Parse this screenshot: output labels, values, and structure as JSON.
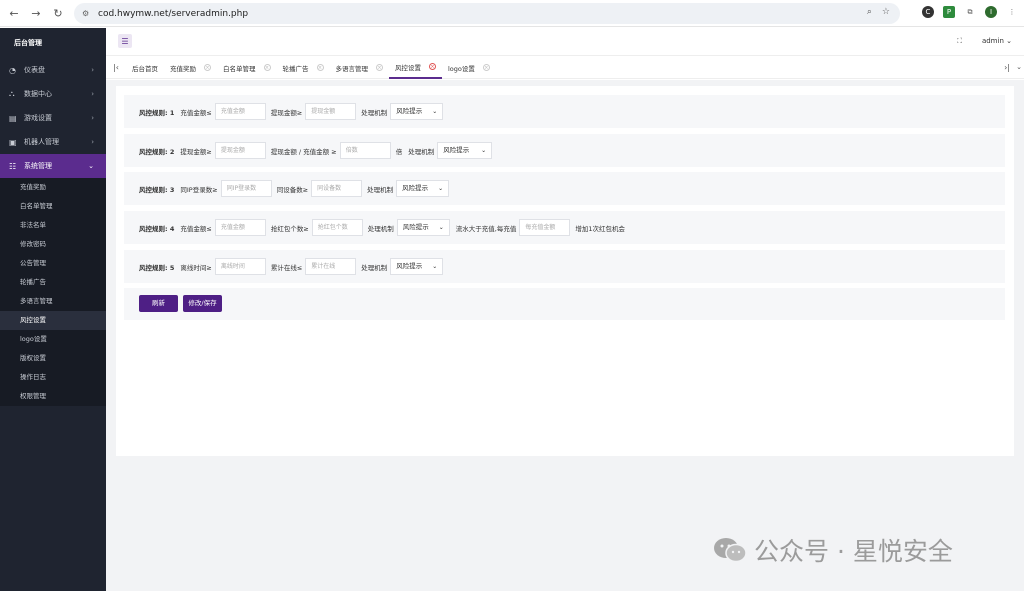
{
  "browser": {
    "url": "cod.hwymw.net/serveradmin.php",
    "profile_initial": "I"
  },
  "sidebar": {
    "title": "后台管理",
    "items": [
      {
        "label": "仪表盘",
        "icon": "dashboard-icon"
      },
      {
        "label": "数据中心",
        "icon": "data-center-icon"
      },
      {
        "label": "游戏设置",
        "icon": "game-settings-icon"
      },
      {
        "label": "机器人管理",
        "icon": "robot-icon"
      },
      {
        "label": "系统管理",
        "icon": "system-icon"
      }
    ],
    "sub_items": [
      "充值奖励",
      "白名单管理",
      "非法名单",
      "修改密码",
      "公告管理",
      "轮播广告",
      "多语言管理",
      "风控设置",
      "logo设置",
      "版权设置",
      "操作日志",
      "权限管理"
    ]
  },
  "header": {
    "admin_label": "admin"
  },
  "tabs": [
    {
      "label": "后台首页"
    },
    {
      "label": "充值奖励"
    },
    {
      "label": "白名单管理"
    },
    {
      "label": "轮播广告"
    },
    {
      "label": "多语言管理"
    },
    {
      "label": "风控设置"
    },
    {
      "label": "logo设置"
    }
  ],
  "rules": {
    "r1": {
      "title": "风控规则: 1",
      "label_a": "充值金额≤",
      "placeholder_a": "充值金额",
      "label_b": "提现金额≥",
      "placeholder_b": "提现金额",
      "label_mech": "处理机制",
      "mech_value": "风险提示"
    },
    "r2": {
      "title": "风控规则: 2",
      "label_a": "提现金额≥",
      "placeholder_a": "提现金额",
      "label_b": "提现金额 / 充值金额 ≥",
      "placeholder_b": "倍数",
      "unit": "倍",
      "label_mech": "处理机制",
      "mech_value": "风险提示"
    },
    "r3": {
      "title": "风控规则: 3",
      "label_a": "同IP登录数≥",
      "placeholder_a": "同IP登录数",
      "label_b": "同设备数≥",
      "placeholder_b": "同设备数",
      "label_mech": "处理机制",
      "mech_value": "风险提示"
    },
    "r4": {
      "title": "风控规则: 4",
      "label_a": "充值金额≤",
      "placeholder_a": "充值金额",
      "label_b": "抢红包个数≥",
      "placeholder_b": "抢红包个数",
      "label_mech": "处理机制",
      "mech_value": "风险提示",
      "label_c": "流水大于充值,每充值",
      "placeholder_c": "每充值金额",
      "suffix": "增加1次红包机会"
    },
    "r5": {
      "title": "风控规则: 5",
      "label_a": "离线时间≥",
      "placeholder_a": "离线时间",
      "label_b": "累计在线≤",
      "placeholder_b": "累计在线",
      "label_mech": "处理机制",
      "mech_value": "风险提示"
    }
  },
  "buttons": {
    "refresh": "刷新",
    "save": "修改/保存"
  },
  "watermark": {
    "text": "公众号 · 星悦安全"
  },
  "colors": {
    "brand": "#4e1f85",
    "sidebar_bg": "#1f2430",
    "active_menu": "#5b2c8e"
  }
}
